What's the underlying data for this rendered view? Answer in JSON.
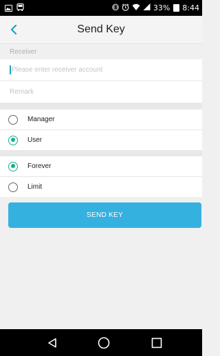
{
  "status_bar": {
    "battery_percent": "33%",
    "time": "8:44",
    "icons": [
      "gallery-notification-icon",
      "bus-notification-icon",
      "bluetooth-icon",
      "alarm-icon",
      "wifi-icon",
      "signal-icon",
      "battery-icon"
    ]
  },
  "header": {
    "title": "Send Key",
    "back_icon": "chevron-left-icon"
  },
  "form": {
    "receiver_label": "Receiver",
    "receiver_placeholder": "Please enter receiver account",
    "receiver_value": "",
    "remark_placeholder": "Remark",
    "remark_value": ""
  },
  "role_options": [
    {
      "label": "Manager",
      "selected": false
    },
    {
      "label": "User",
      "selected": true
    }
  ],
  "validity_options": [
    {
      "label": "Forever",
      "selected": true
    },
    {
      "label": "Limit",
      "selected": false
    }
  ],
  "send_button": {
    "label": "SEND KEY"
  },
  "nav_bar": {
    "buttons": [
      "back-triangle-icon",
      "home-circle-icon",
      "recents-square-icon"
    ]
  },
  "colors": {
    "accent": "#35b1df",
    "radio_selected": "#14b08f",
    "back_chevron": "#16a5c8"
  }
}
